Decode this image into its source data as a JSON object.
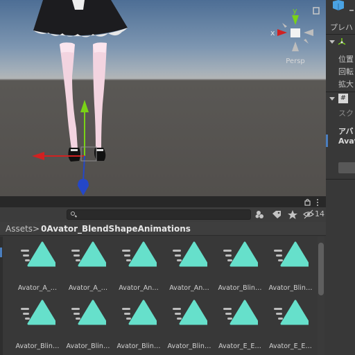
{
  "scene": {
    "gizmo": {
      "label": "Persp",
      "axis_y": "y",
      "axis_x": "x"
    }
  },
  "inspector": {
    "prefab_label": "プレハ",
    "transform": {
      "position": "位置",
      "rotation": "回転",
      "scale": "拡大"
    },
    "script": {
      "label": "スク",
      "section_bold": "アバ",
      "field_bold": "Avat"
    }
  },
  "project": {
    "hidden_count": "14",
    "breadcrumb": {
      "root": "Assets",
      "separator": ">",
      "folder": "0Avator_BlendShapeAnimations"
    },
    "assets": [
      {
        "name": "Avator_A_…"
      },
      {
        "name": "Avator_A_…"
      },
      {
        "name": "Avator_An…"
      },
      {
        "name": "Avator_An…"
      },
      {
        "name": "Avator_Blin…"
      },
      {
        "name": "Avator_Blin…"
      },
      {
        "name": "Avator_Blin…"
      },
      {
        "name": "Avator_Blin…"
      },
      {
        "name": "Avator_Blin…"
      },
      {
        "name": "Avator_Blin…"
      },
      {
        "name": "Avator_E_E…"
      },
      {
        "name": "Avator_E_E…"
      }
    ]
  },
  "colors": {
    "accent": "#66e0cb",
    "selection": "#4a7ebf",
    "axis_x": "#d12121",
    "axis_y": "#7ad316",
    "axis_z": "#2447c8"
  }
}
